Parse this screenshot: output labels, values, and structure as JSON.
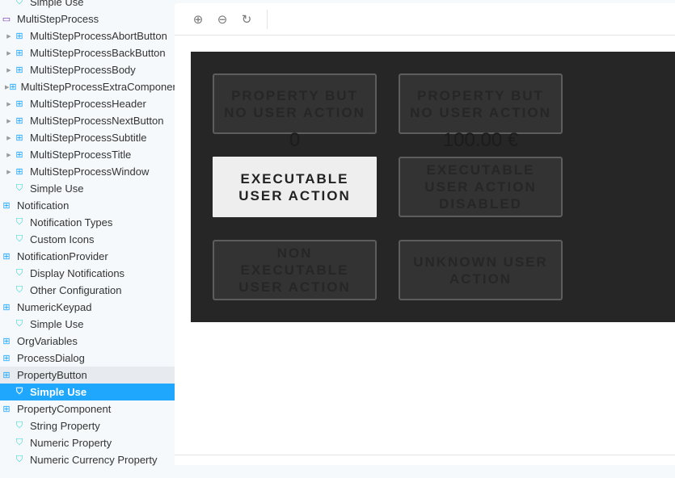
{
  "sidebar": {
    "items": [
      {
        "label": "Simple Use",
        "type": "story",
        "indent": 1
      },
      {
        "label": "MultiStepProcess",
        "type": "folder",
        "indent": 0
      },
      {
        "label": "MultiStepProcessAbortButton",
        "type": "component",
        "indent": 1,
        "arrow": true
      },
      {
        "label": "MultiStepProcessBackButton",
        "type": "component",
        "indent": 1,
        "arrow": true
      },
      {
        "label": "MultiStepProcessBody",
        "type": "component",
        "indent": 1,
        "arrow": true
      },
      {
        "label": "MultiStepProcessExtraComponent",
        "type": "component",
        "indent": 1,
        "arrow": true
      },
      {
        "label": "MultiStepProcessHeader",
        "type": "component",
        "indent": 1,
        "arrow": true
      },
      {
        "label": "MultiStepProcessNextButton",
        "type": "component",
        "indent": 1,
        "arrow": true
      },
      {
        "label": "MultiStepProcessSubtitle",
        "type": "component",
        "indent": 1,
        "arrow": true
      },
      {
        "label": "MultiStepProcessTitle",
        "type": "component",
        "indent": 1,
        "arrow": true
      },
      {
        "label": "MultiStepProcessWindow",
        "type": "component",
        "indent": 1,
        "arrow": true
      },
      {
        "label": "Simple Use",
        "type": "story",
        "indent": 1
      },
      {
        "label": "Notification",
        "type": "component",
        "indent": 0
      },
      {
        "label": "Notification Types",
        "type": "story",
        "indent": 1
      },
      {
        "label": "Custom Icons",
        "type": "story",
        "indent": 1
      },
      {
        "label": "NotificationProvider",
        "type": "component",
        "indent": 0
      },
      {
        "label": "Display Notifications",
        "type": "story",
        "indent": 1
      },
      {
        "label": "Other Configuration",
        "type": "story",
        "indent": 1
      },
      {
        "label": "NumericKeypad",
        "type": "component",
        "indent": 0
      },
      {
        "label": "Simple Use",
        "type": "story",
        "indent": 1
      },
      {
        "label": "OrgVariables",
        "type": "component",
        "indent": 0
      },
      {
        "label": "ProcessDialog",
        "type": "component",
        "indent": 0
      },
      {
        "label": "PropertyButton",
        "type": "component",
        "indent": 0,
        "state": "hl"
      },
      {
        "label": "Simple Use",
        "type": "story",
        "indent": 1,
        "state": "sel"
      },
      {
        "label": "PropertyComponent",
        "type": "component",
        "indent": 0
      },
      {
        "label": "String Property",
        "type": "story",
        "indent": 1
      },
      {
        "label": "Numeric Property",
        "type": "story",
        "indent": 1
      },
      {
        "label": "Numeric Currency Property",
        "type": "story",
        "indent": 1
      }
    ]
  },
  "toolbar": {
    "zoom_in": "zoom-in-icon",
    "zoom_out": "zoom-out-icon",
    "reset": "reset-zoom-icon"
  },
  "preview": {
    "btn1": "PROPERTY BUT NO USER ACTION",
    "val1": "0",
    "btn2": "PROPERTY BUT NO USER ACTION",
    "val2": "100.00 €",
    "btn3": "EXECUTABLE USER ACTION",
    "btn4": "EXECUTABLE USER ACTION DISABLED",
    "btn5": "NON EXECUTABLE USER ACTION",
    "btn6": "UNKNOWN USER ACTION"
  },
  "colors": {
    "accent": "#1ea7fd",
    "canvas": "#262626"
  }
}
